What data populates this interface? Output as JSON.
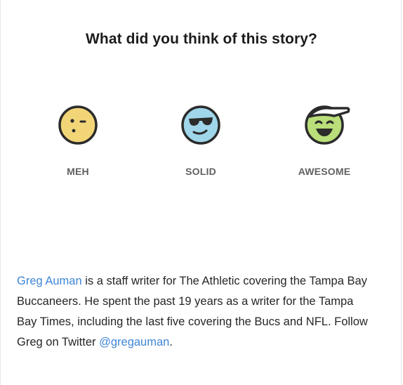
{
  "survey": {
    "question": "What did you think of this story?",
    "options": [
      {
        "label": "MEH",
        "icon": "meh-face-icon",
        "color": "#f2d577"
      },
      {
        "label": "SOLID",
        "icon": "sunglasses-face-icon",
        "color": "#9fd6ea"
      },
      {
        "label": "AWESOME",
        "icon": "laughing-cap-face-icon",
        "color": "#b9de7a"
      }
    ]
  },
  "bio": {
    "author_name": "Greg Auman",
    "text_1": " is a staff writer for The Athletic covering the Tampa Bay Buccaneers. He spent the past 19 years as a writer for the Tampa Bay Times, including the last five covering the Bucs and NFL. Follow Greg on Twitter ",
    "twitter_handle": "@gregauman",
    "text_2": "."
  },
  "colors": {
    "link": "#3f86d6",
    "outline": "#2b2b2b"
  }
}
